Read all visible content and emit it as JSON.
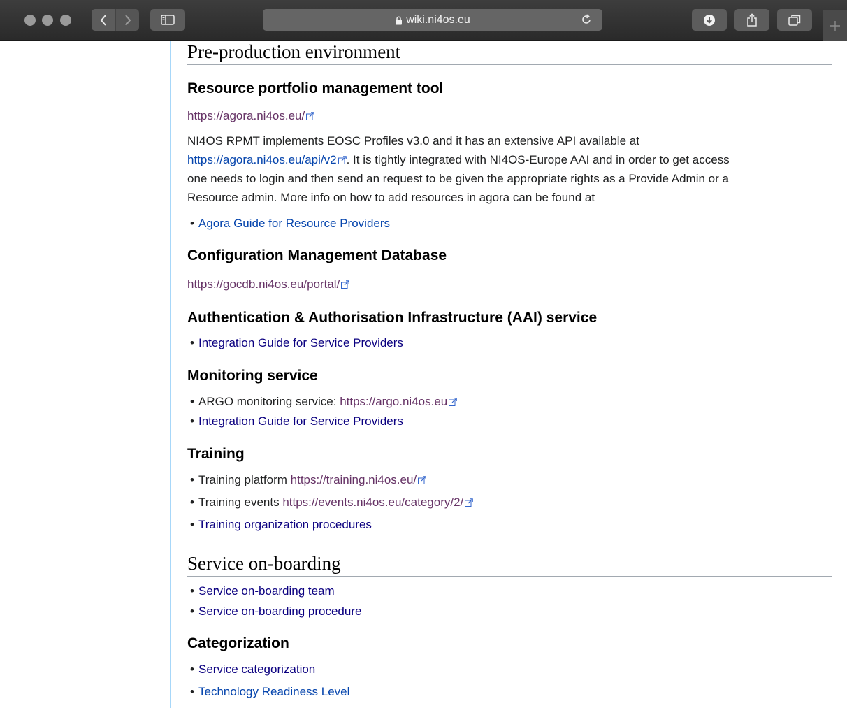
{
  "browser": {
    "url": "wiki.ni4os.eu",
    "colors": {
      "chrome": "#2f2f2f",
      "button": "#5c5c5c"
    }
  },
  "page": {
    "h2_preprod": "Pre-production environment",
    "rpmt": {
      "title": "Resource portfolio management tool",
      "link": "https://agora.ni4os.eu/",
      "para_before": "NI4OS RPMT implements EOSC Profiles v3.0 and it has an extensive API available at",
      "api_link": "https://agora.ni4os.eu/api/v2",
      "para_after_1": ". It is tightly integrated with NI4OS-Europe AAI and in order to get access",
      "para_line3": "one needs to login and then send an request to be given the appropriate rights as a Provide Admin or a",
      "para_line4": "Resource admin. More info on how to add resources in agora can be found at",
      "guide": "Agora Guide for Resource Providers"
    },
    "cmdb": {
      "title": "Configuration Management Database",
      "link": "https://gocdb.ni4os.eu/portal/"
    },
    "aai": {
      "title": "Authentication & Authorisation Infrastructure (AAI) service",
      "guide": "Integration Guide for Service Providers"
    },
    "monitoring": {
      "title": "Monitoring service",
      "argo_label": "ARGO monitoring service: ",
      "argo_link": "https://argo.ni4os.eu",
      "guide": "Integration Guide for Service Providers"
    },
    "training": {
      "title": "Training",
      "platform_label": "Training platform ",
      "platform_link": "https://training.ni4os.eu/",
      "events_label": "Training events ",
      "events_link": "https://events.ni4os.eu/category/2/",
      "procedures": "Training organization procedures"
    },
    "h2_onboarding": "Service on-boarding",
    "onboarding": {
      "team": "Service on-boarding team",
      "procedure": "Service on-boarding procedure"
    },
    "categorization": {
      "title": "Categorization",
      "service_cat": "Service categorization",
      "trl": "Technology Readiness Level"
    },
    "colors": {
      "visited_external": "#663366",
      "internal_link": "#0645ad",
      "heading_rule": "#a2a9b1"
    }
  }
}
